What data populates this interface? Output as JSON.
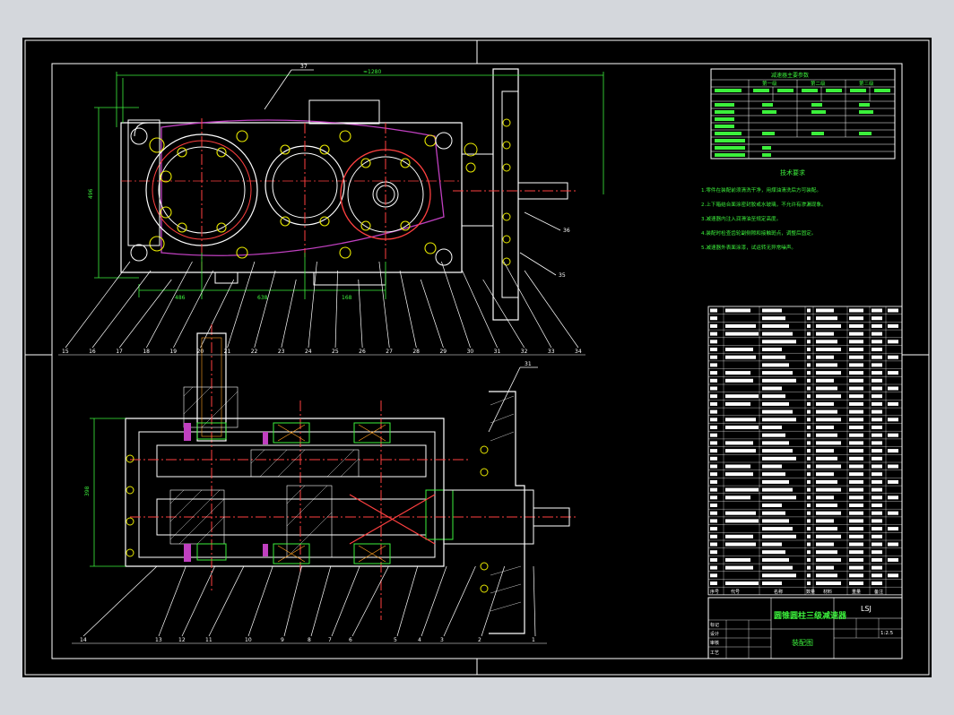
{
  "drawing": {
    "title_main": "圆锥圆柱三级减速器",
    "title_sub": "装配图",
    "code": "LSJ",
    "scale": "1:2.5"
  },
  "top_view": {
    "dim_overall": "≈1280",
    "dim_left_a": "486",
    "dim_left_b": "638",
    "dim_right": "168",
    "dim_height": "496",
    "callout_top": "37",
    "callouts_right": [
      "36",
      "35"
    ],
    "callouts_bottom": [
      "15",
      "16",
      "17",
      "18",
      "19",
      "20",
      "21",
      "22",
      "23",
      "24",
      "25",
      "26",
      "27",
      "28",
      "29",
      "30",
      "31",
      "32",
      "33",
      "34"
    ]
  },
  "section_view": {
    "dim_height": "398",
    "callout_right": "31",
    "callouts_bottom": [
      "14",
      "13",
      "12",
      "11",
      "10",
      "9",
      "8",
      "7",
      "6",
      "5",
      "4",
      "3",
      "2",
      "1"
    ]
  },
  "param_table": {
    "title": "减速器主要参数",
    "stages": [
      "第一级",
      "第二级",
      "第三级"
    ]
  },
  "tech_req": {
    "title": "技术要求",
    "lines": [
      "1.零件在装配前须清洗干净，用煤油清洗后方可装配。",
      "2.上下箱结合面涂密封胶或水玻璃，不允许有渗漏现象。",
      "3.减速器内注入润滑油至规定高度。",
      "4.装配时检查齿轮副侧隙和接触斑点，调整后固定。",
      "5.减速器外表面涂漆，试运转无异常噪声。"
    ]
  },
  "parts_table": {
    "header": [
      "序号",
      "代号",
      "名称",
      "数量",
      "材料",
      "重量",
      "备注"
    ]
  },
  "title_block": {
    "left_rows": [
      "标记",
      "设计",
      "审核",
      "工艺"
    ]
  }
}
